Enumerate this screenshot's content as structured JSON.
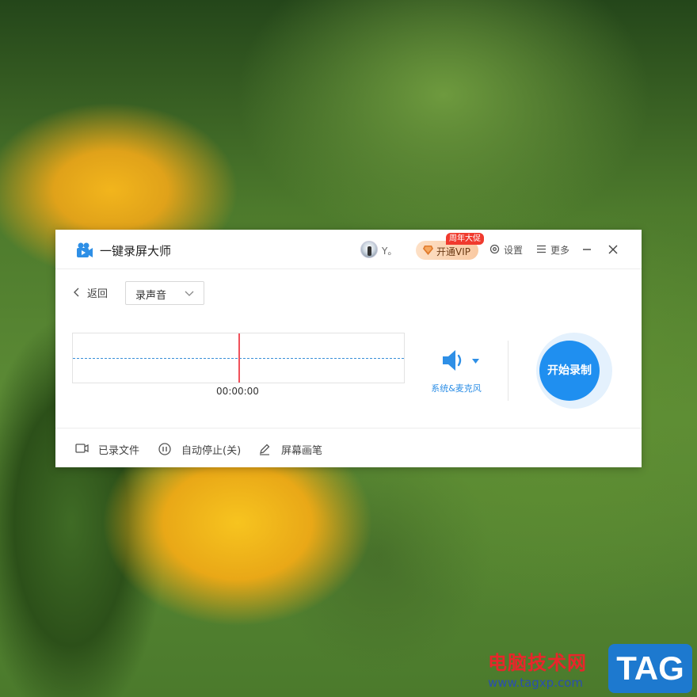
{
  "app": {
    "title": "一键录屏大师",
    "username": "Y。",
    "vip_label": "开通VIP",
    "promo_badge": "周年大促",
    "settings_label": "设置",
    "more_label": "更多"
  },
  "toolbar": {
    "back_label": "返回",
    "mode_selected": "录声音"
  },
  "recorder": {
    "timer": "00:00:00",
    "audio_source": "系统&麦克风",
    "record_label": "开始录制"
  },
  "footer": {
    "files_label": "已录文件",
    "autostop_label": "自动停止(关)",
    "pen_label": "屏幕画笔"
  },
  "watermark": {
    "site_name": "电脑技术网",
    "url": "www.tagxp.com",
    "logo_text": "TAG"
  },
  "colors": {
    "accent": "#1f8ff0",
    "playhead": "#f0505a",
    "promo": "#f03a2e"
  },
  "icons": [
    "camera-logo-icon",
    "diamond-icon",
    "gear-icon",
    "menu-icon",
    "minimize-icon",
    "close-icon",
    "chevron-left-icon",
    "chevron-down-icon",
    "speaker-icon",
    "caret-down-icon",
    "video-file-icon",
    "pause-circle-icon",
    "pen-icon"
  ]
}
